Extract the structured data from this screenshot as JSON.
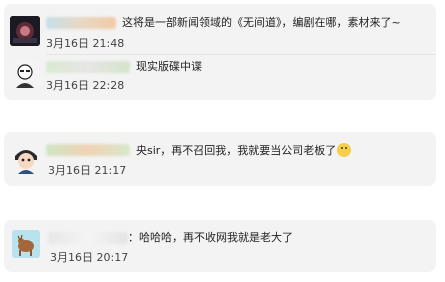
{
  "comments": [
    {
      "text": "这将是一部新闻领域的《无间道》，编剧在哪，素材来了~",
      "time": "3月16日 21:48",
      "reply": {
        "text": "现实版碟中谍",
        "time": "3月16日 22:28"
      }
    },
    {
      "text": "央sir，再不召回我，我就要当公司老板了",
      "time": "3月16日 21:17"
    },
    {
      "text": "：哈哈哈，再不收网我就是老大了",
      "time": "3月16日 20:17"
    }
  ]
}
